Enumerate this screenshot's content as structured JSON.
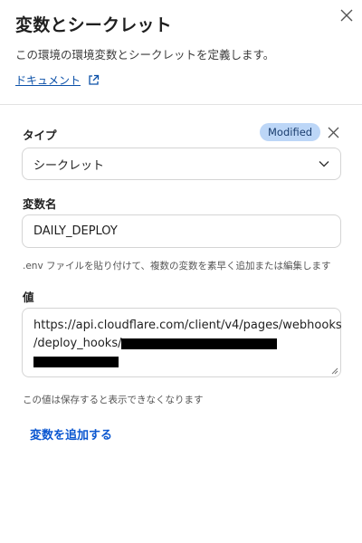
{
  "header": {
    "title": "変数とシークレット",
    "subtitle": "この環境の環境変数とシークレットを定義します。",
    "doc_link": "ドキュメント"
  },
  "form": {
    "type_label": "タイプ",
    "badge": "Modified",
    "type_value": "シークレット",
    "name_label": "変数名",
    "name_value": "DAILY_DEPLOY",
    "env_hint": ".env ファイルを貼り付けて、複数の変数を素早く追加または編集します",
    "value_label": "値",
    "value_line1": "https://api.cloudflare.com/client/v4/pages/webhooks",
    "value_line2": "/deploy_hooks/",
    "value_hint": "この値は保存すると表示できなくなります",
    "add_variable": "変数を追加する"
  },
  "colors": {
    "accent": "#0b57d0",
    "badge_bg": "#bcd6f7",
    "link": "#0b50a8"
  },
  "icons": {
    "close": "close-icon",
    "external": "external-link-icon",
    "dropdown": "chevron-down-icon"
  }
}
